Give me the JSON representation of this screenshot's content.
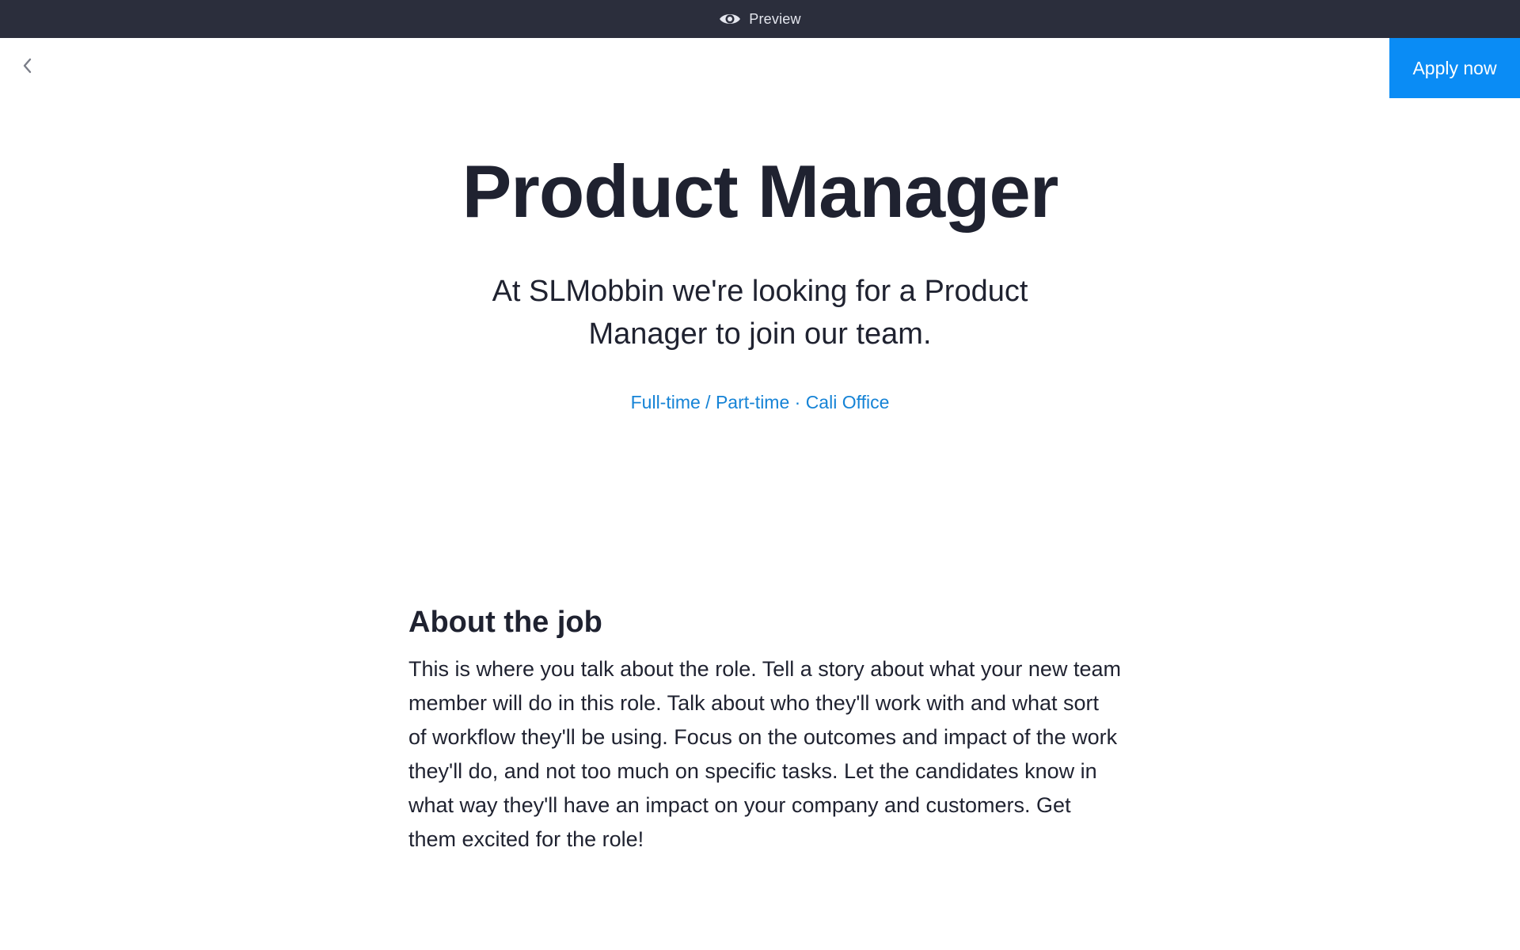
{
  "preview_bar": {
    "icon": "eye-icon",
    "label": "Preview"
  },
  "nav": {
    "back_icon": "chevron-left-icon"
  },
  "actions": {
    "apply_label": "Apply now"
  },
  "colors": {
    "preview_bar_bg": "#2b2e3c",
    "accent": "#0a8cf5",
    "meta_link": "#1583d6",
    "text": "#1f2230"
  },
  "job": {
    "title": "Product Manager",
    "subtitle": "At SLMobbin we're looking for a Product Manager to join our team.",
    "meta": "Full-time / Part-time · Cali Office"
  },
  "about": {
    "heading": "About the job",
    "body": "This is where you talk about the role. Tell a story about what your new team member will do in this role. Talk about who they'll work with and what sort of workflow they'll be using. Focus on the outcomes and impact of the work they'll do, and not too much on specific tasks. Let the candidates know in what way they'll have an impact on your company and customers. Get them excited for the role!"
  }
}
